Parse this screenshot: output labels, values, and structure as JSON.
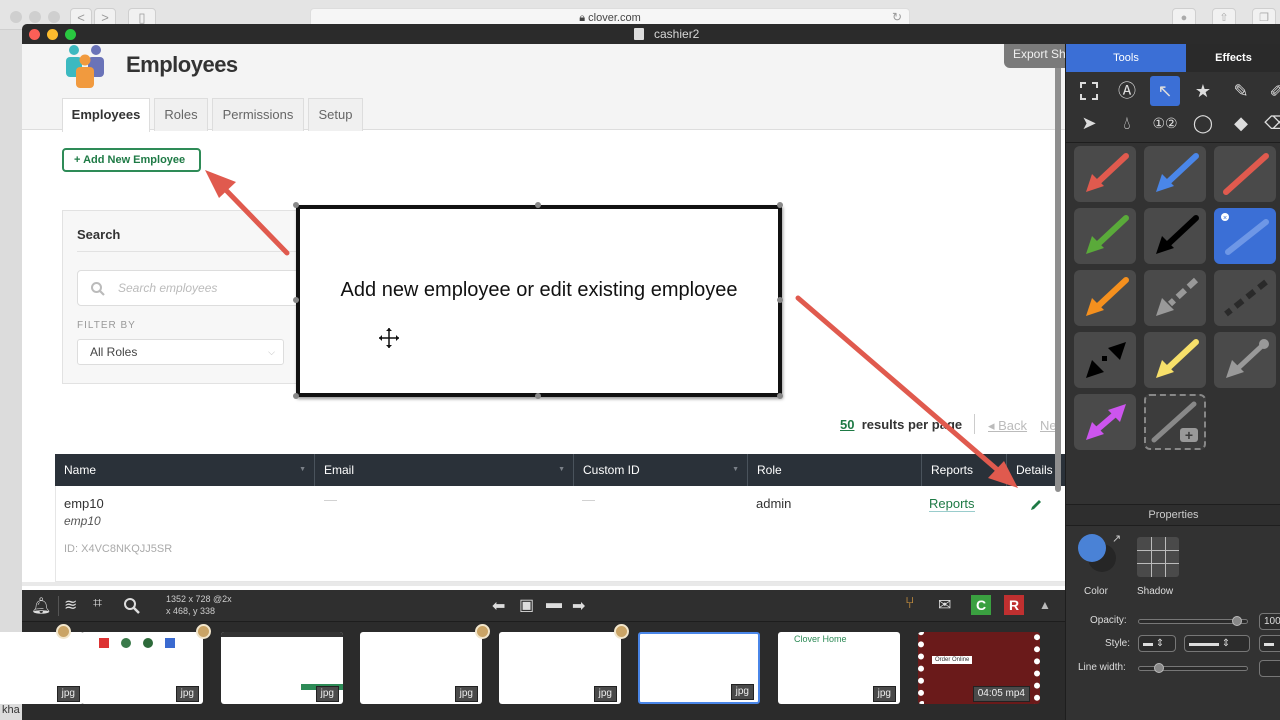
{
  "browser": {
    "url": "clover.com",
    "back_label": "<",
    "forward_label": ">"
  },
  "window": {
    "document_title": "cashier2"
  },
  "page": {
    "title": "Employees",
    "tabs": [
      {
        "label": "Employees",
        "active": true
      },
      {
        "label": "Roles",
        "active": false
      },
      {
        "label": "Permissions",
        "active": false
      },
      {
        "label": "Setup",
        "active": false
      }
    ],
    "add_button_label": "+ Add New Employee",
    "search": {
      "heading": "Search",
      "placeholder": "Search employees",
      "filter_label": "FILTER BY",
      "filter_value": "All Roles"
    },
    "pagination": {
      "per_page": "50",
      "per_page_label": "results per page",
      "back_label": "◂ Back",
      "next_label": "Ne"
    },
    "table": {
      "columns": [
        "Name",
        "Email",
        "Custom ID",
        "Role",
        "Reports",
        "Details"
      ],
      "rows": [
        {
          "name": "emp10",
          "nickname": "emp10",
          "id": "ID: X4VC8NKQJJ5SR",
          "email": "—",
          "custom_id": "—",
          "role": "admin",
          "reports_link": "Reports",
          "details_icon": "pencil-icon"
        }
      ]
    },
    "accent_color": "#1e7a45",
    "header_color": "#2a3139"
  },
  "annotation": {
    "callout_text": "Add new employee or edit existing employee",
    "arrow_color": "#e05a4e"
  },
  "export_pill": "Export Shi",
  "tools_panel": {
    "tabs": [
      "Tools",
      "Effects"
    ],
    "active_tab": "Tools",
    "tool_icons": [
      "selection-rect-icon",
      "callout-icon",
      "arrow-tool-icon",
      "stamp-icon",
      "pen-icon",
      "highlighter-icon",
      "pointer-icon",
      "blur-drop-icon",
      "step-numbers-icon",
      "shape-icon",
      "fill-icon",
      "eraser-icon"
    ],
    "properties_heading": "Properties",
    "color_label": "Color",
    "shadow_label": "Shadow",
    "opacity_label": "Opacity:",
    "opacity_value": "100",
    "opacity_fraction": 0.95,
    "style_label": "Style:",
    "line_width_label": "Line width:",
    "line_width_fraction": 0.15,
    "selected_color": "#4a82d6"
  },
  "bottom_bar": {
    "dimensions": "1352 x 728 @2x",
    "cursor": "x 468,  y 338",
    "thumbnails": [
      {
        "badge": "jpg"
      },
      {
        "badge": "jpg"
      },
      {
        "badge": "jpg"
      },
      {
        "badge": "jpg"
      },
      {
        "badge": "jpg"
      },
      {
        "badge": "jpg",
        "selected": true
      },
      {
        "badge": "jpg",
        "title": "Clover Home"
      },
      {
        "badge": "04:05 mp4",
        "title": "Order Online"
      }
    ]
  },
  "dock_label": "kha"
}
